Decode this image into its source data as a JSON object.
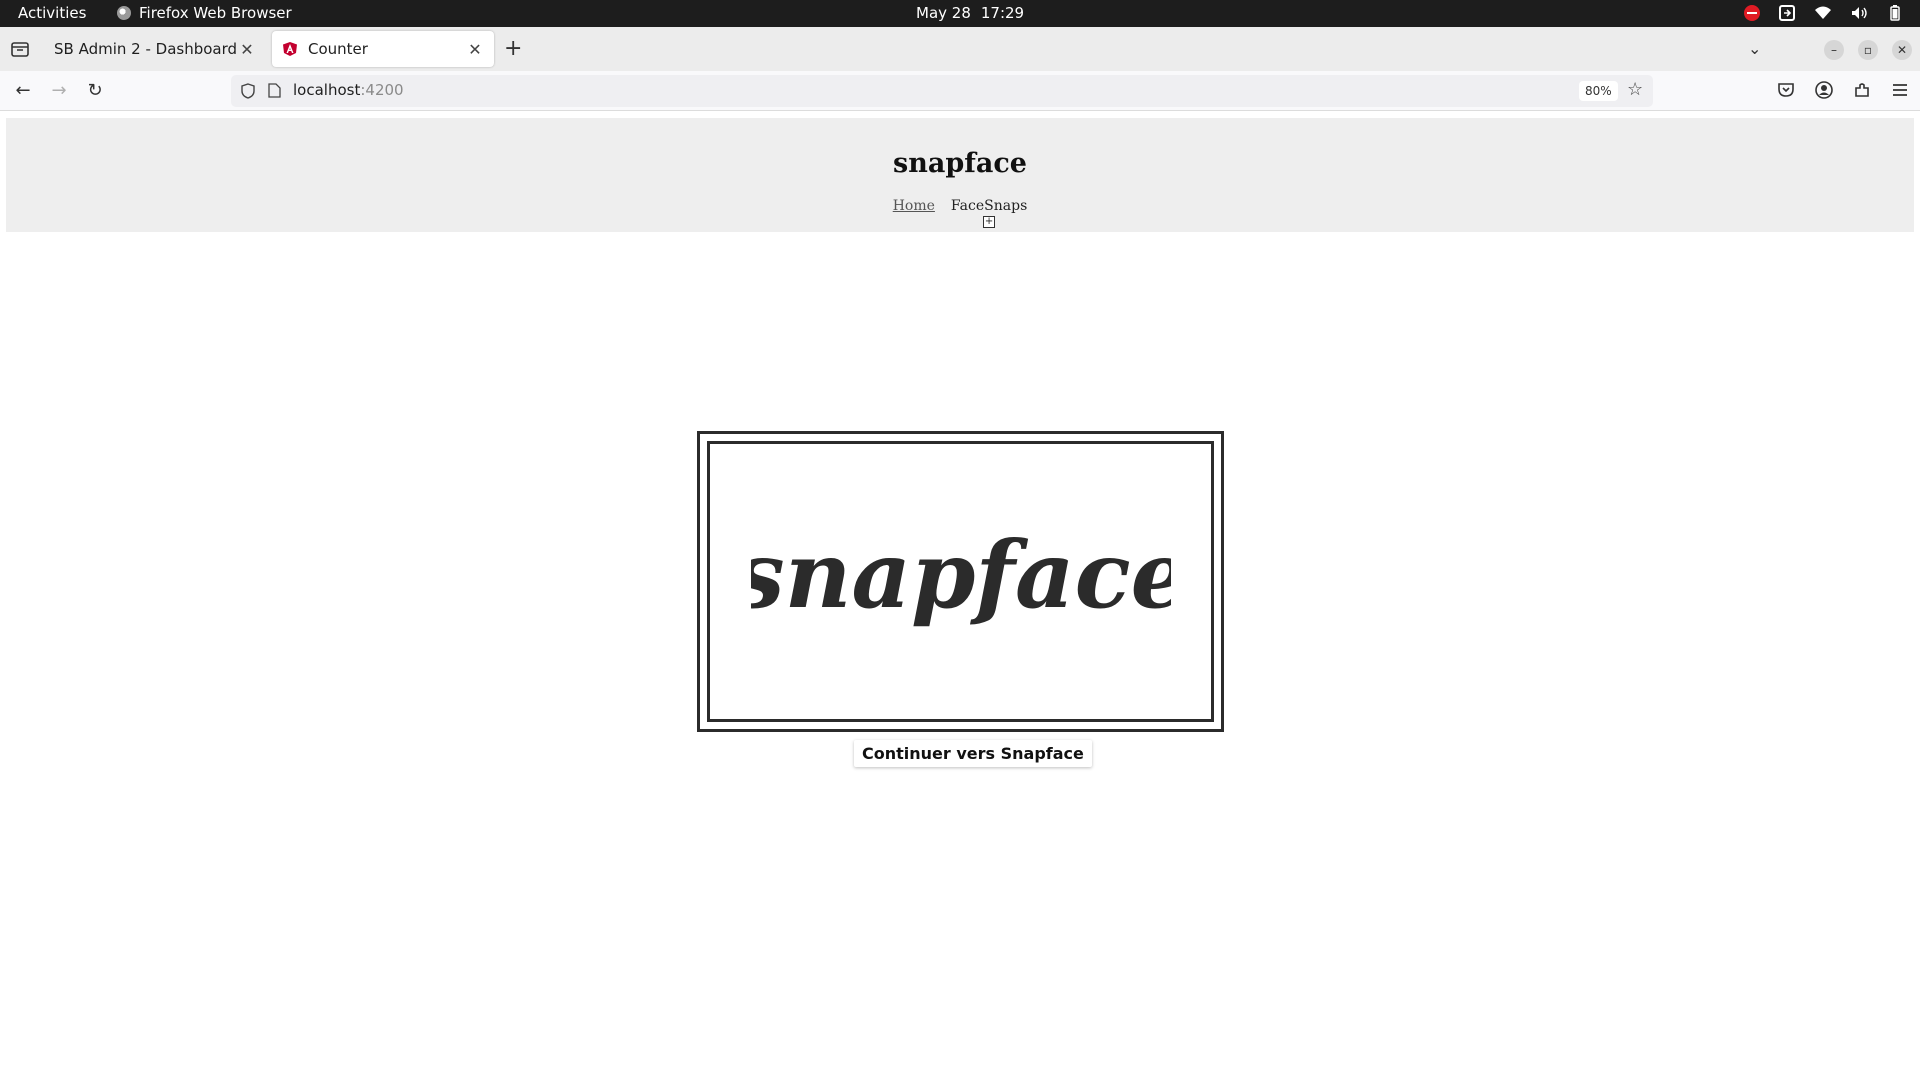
{
  "system": {
    "activities": "Activities",
    "app_name": "Firefox Web Browser",
    "date": "May 28",
    "time": "17:29"
  },
  "tabs": [
    {
      "title": "SB Admin 2 - Dashboard",
      "active": false
    },
    {
      "title": "Counter",
      "active": true
    }
  ],
  "navbar": {
    "url_host": "localhost",
    "url_port": ":4200",
    "zoom": "80%"
  },
  "page": {
    "site_title": "snapface",
    "nav": {
      "home": "Home",
      "facesnaps": "FaceSnaps",
      "plus": "+"
    },
    "logo_text": "snapface",
    "continue_button": "Continuer vers Snapface"
  },
  "icons": {
    "tab_close": "close-icon",
    "new_tab": "plus-icon",
    "back": "arrow-left-icon",
    "forward": "arrow-right-icon",
    "reload": "reload-icon",
    "bookmark": "star-icon"
  },
  "colors": {
    "header_bg": "#eeeeee",
    "frame": "#2b2b2b",
    "topbar": "#1d1d1d",
    "dnd": "#e01b24"
  }
}
